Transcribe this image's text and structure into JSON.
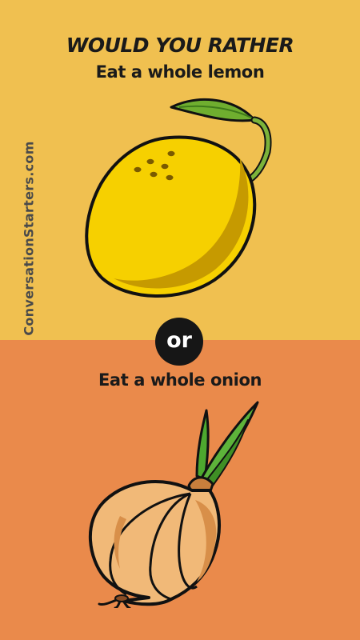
{
  "header": {
    "headline": "WOULD YOU RATHER",
    "option_a": "Eat a whole lemon",
    "option_b": "Eat a whole onion"
  },
  "divider": {
    "label": "or"
  },
  "brand": {
    "text": "ConversationStarters.com"
  },
  "illustrations": {
    "top": "lemon-icon",
    "bottom": "onion-icon"
  },
  "colors": {
    "top_background": "#f0c050",
    "bottom_background": "#ea8a4b",
    "or_circle": "#161616",
    "text": "#1a1a1a"
  }
}
